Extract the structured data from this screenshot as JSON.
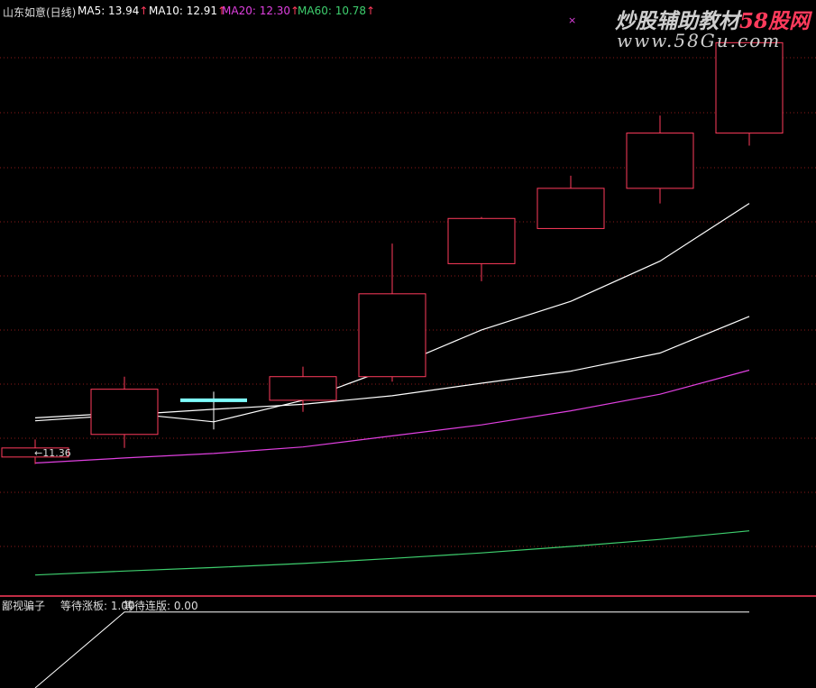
{
  "header": {
    "stock": "山东如意(日线)",
    "ma5": "MA5: 13.94",
    "ma10": "MA10: 12.91",
    "ma20": "MA20: 12.30",
    "ma60": "MA60: 10.78",
    "arrow": "↑"
  },
  "watermark": {
    "line1_main": "炒股辅助教材",
    "line1_accent": "58股网",
    "line2": "www.58Gu.com"
  },
  "low_label": "←11.36",
  "marker": "×",
  "sub_panel": {
    "name": "鄙视骗子",
    "wait_limit": "等待涨板: 1.00",
    "wait_consec": "等待连版: 0.00"
  },
  "colors": {
    "background": "#000000",
    "up_candle": "#ff3b5c",
    "grid": "#8b1a1a",
    "ma5": "#ffffff",
    "ma10": "#ffffff",
    "ma20": "#e040e0",
    "ma60": "#3ecf6e",
    "doji": "#7fffff",
    "sub_line": "#ffffff"
  },
  "chart_data": {
    "type": "candlestick",
    "candles": [
      {
        "open": 11.5,
        "close": 11.68,
        "high": 11.85,
        "low": 11.36
      },
      {
        "open": 11.95,
        "close": 12.85,
        "high": 13.1,
        "low": 11.68
      },
      {
        "open": 12.63,
        "close": 12.63,
        "high": 12.8,
        "low": 12.05,
        "doji": true
      },
      {
        "open": 12.63,
        "close": 13.1,
        "high": 13.3,
        "low": 12.4
      },
      {
        "open": 13.1,
        "close": 14.75,
        "high": 15.75,
        "low": 13.0
      },
      {
        "open": 15.35,
        "close": 16.25,
        "high": 16.28,
        "low": 15.0
      },
      {
        "open": 16.05,
        "close": 16.85,
        "high": 17.1,
        "low": 16.05
      },
      {
        "open": 16.85,
        "close": 17.95,
        "high": 18.3,
        "low": 16.55
      },
      {
        "open": 17.95,
        "close": 19.75,
        "high": 19.75,
        "low": 17.7
      }
    ],
    "series": [
      {
        "name": "MA5",
        "values": [
          12.28,
          12.38,
          12.2,
          12.63,
          13.28,
          14.03,
          14.6,
          15.4,
          16.55
        ]
      },
      {
        "name": "MA10",
        "values": [
          12.22,
          12.34,
          12.45,
          12.55,
          12.72,
          12.97,
          13.21,
          13.57,
          14.3
        ]
      },
      {
        "name": "MA20",
        "values": [
          11.38,
          11.48,
          11.57,
          11.7,
          11.92,
          12.14,
          12.42,
          12.75,
          13.23
        ]
      },
      {
        "name": "MA60",
        "values": [
          9.15,
          9.23,
          9.3,
          9.38,
          9.48,
          9.59,
          9.72,
          9.86,
          10.03
        ]
      }
    ],
    "sub_series": [
      {
        "name": "等待涨板",
        "values": [
          0.0,
          1.0,
          1.0,
          1.0,
          1.0,
          1.0,
          1.0,
          1.0,
          1.0
        ]
      }
    ],
    "ylim": [
      8.75,
      20.6
    ],
    "sub_ylim": [
      0,
      1.2
    ]
  }
}
